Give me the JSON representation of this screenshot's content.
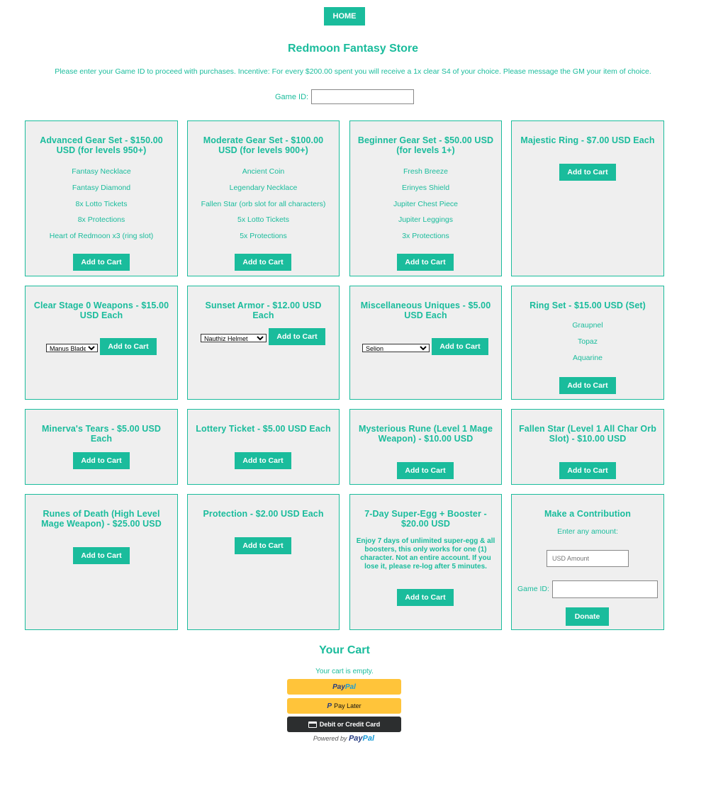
{
  "nav": {
    "home_label": "HOME"
  },
  "header": {
    "title": "Redmoon Fantasy Store",
    "notice": "Please enter your Game ID to proceed with purchases. Incentive: For every $200.00 spent you will receive a 1x clear S4 of your choice. Please message the GM your item of choice.",
    "gameid_label": "Game ID:"
  },
  "add_to_cart_label": "Add to Cart",
  "cards": [
    {
      "title": "Advanced Gear Set - $150.00 USD (for levels 950+)",
      "items": [
        "Fantasy Necklace",
        "Fantasy Diamond",
        "8x Lotto Tickets",
        "8x Protections",
        "Heart of Redmoon x3 (ring slot)"
      ]
    },
    {
      "title": "Moderate Gear Set - $100.00 USD (for levels 900+)",
      "items": [
        "Ancient Coin",
        "Legendary Necklace",
        "Fallen Star (orb slot for all characters)",
        "5x Lotto Tickets",
        "5x Protections"
      ]
    },
    {
      "title": "Beginner Gear Set - $50.00 USD (for levels 1+)",
      "items": [
        "Fresh Breeze",
        "Erinyes Shield",
        "Jupiter Chest Piece",
        "Jupiter Leggings",
        "3x Protections"
      ]
    },
    {
      "title": "Majestic Ring - $7.00 USD Each"
    },
    {
      "title": "Clear Stage 0 Weapons - $15.00 USD Each",
      "select": "Manus Blade"
    },
    {
      "title": "Sunset Armor - $12.00 USD Each",
      "select": "Nauthiz Helmet"
    },
    {
      "title": "Miscellaneous Uniques - $5.00 USD Each",
      "select": "Selion"
    },
    {
      "title": "Ring Set - $15.00 USD (Set)",
      "items": [
        "Graupnel",
        "Topaz",
        "Aquarine"
      ]
    },
    {
      "title": "Minerva's Tears - $5.00 USD Each"
    },
    {
      "title": "Lottery Ticket - $5.00 USD Each"
    },
    {
      "title": "Mysterious Rune (Level 1 Mage Weapon) - $10.00 USD"
    },
    {
      "title": "Fallen Star (Level 1 All Char Orb Slot) - $10.00 USD"
    },
    {
      "title": "Runes of Death (High Level Mage Weapon) - $25.00 USD"
    },
    {
      "title": "Protection - $2.00 USD Each"
    },
    {
      "title": "7-Day Super-Egg + Booster - $20.00 USD",
      "description": "Enjoy 7 days of unlimited super-egg & all boosters, this only works for one (1) character. Not an entire account. If you lose it, please re-log after 5 minutes."
    }
  ],
  "contribution": {
    "title": "Make a Contribution",
    "subtitle": "Enter any amount:",
    "amount_placeholder": "USD Amount",
    "gameid_label": "Game ID:",
    "donate_label": "Donate"
  },
  "cart": {
    "title": "Your Cart",
    "empty_text": "Your cart is empty.",
    "paypal_part1": "Pay",
    "paypal_part2": "Pal",
    "pay_later": "Pay Later",
    "card_label": "Debit or Credit Card",
    "powered_by": "Powered by"
  },
  "colors": {
    "accent": "#1abc9c",
    "card_bg": "#efefef",
    "paypal_yellow": "#ffc43a",
    "paypal_dark": "#2c2e2f"
  }
}
